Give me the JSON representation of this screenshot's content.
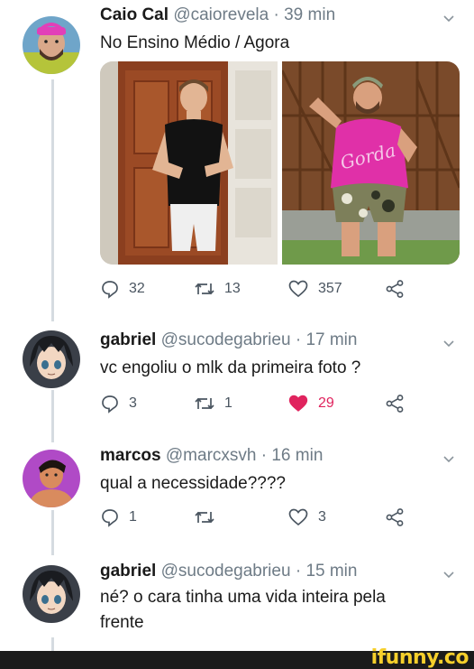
{
  "tweets": [
    {
      "name": "Caio Cal",
      "handle": "@caiorevela",
      "dot": "·",
      "time": "39 min",
      "text": "No Ensino Médio / Agora",
      "replies": "32",
      "retweets": "13",
      "likes": "357",
      "liked": false
    },
    {
      "name": "gabriel",
      "handle": "@sucodegabrieu",
      "dot": "·",
      "time": "17 min",
      "text": "vc engoliu o mlk da primeira foto ?",
      "replies": "3",
      "retweets": "1",
      "likes": "29",
      "liked": true
    },
    {
      "name": "marcos",
      "handle": "@marcxsvh",
      "dot": "·",
      "time": "16 min",
      "text": "qual a necessidade????",
      "replies": "1",
      "retweets": "",
      "likes": "3",
      "liked": false
    },
    {
      "name": "gabriel",
      "handle": "@sucodegabrieu",
      "dot": "·",
      "time": "15 min",
      "text": "né? o cara tinha uma vida inteira pela frente"
    }
  ],
  "photo_shirt_text": "Gorda",
  "watermark": "ifunny.co",
  "colors": {
    "like_red": "#e0245e",
    "muted": "#6e7b86",
    "thread_line": "#d5dbe0",
    "ifunny_yellow": "#f6cf2b"
  }
}
